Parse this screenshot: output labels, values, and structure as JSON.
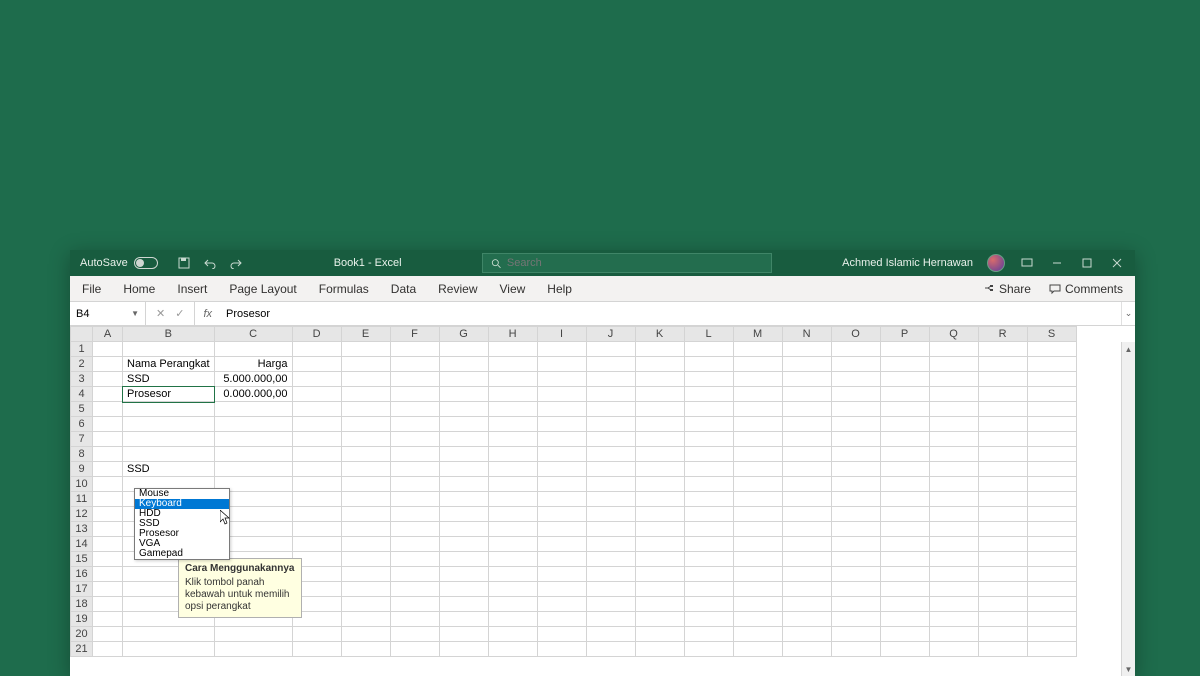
{
  "titlebar": {
    "autosave_label": "AutoSave",
    "autosave_state": "Off",
    "doc_title": "Book1  -  Excel",
    "search_placeholder": "Search",
    "user_name": "Achmed Islamic Hernawan"
  },
  "ribbon": {
    "tabs": [
      "File",
      "Home",
      "Insert",
      "Page Layout",
      "Formulas",
      "Data",
      "Review",
      "View",
      "Help"
    ],
    "share": "Share",
    "comments": "Comments"
  },
  "formula_bar": {
    "name_box": "B4",
    "fx_label": "fx",
    "formula": "Prosesor"
  },
  "columns": [
    "A",
    "B",
    "C",
    "D",
    "E",
    "F",
    "G",
    "H",
    "I",
    "J",
    "K",
    "L",
    "M",
    "N",
    "O",
    "P",
    "Q",
    "R",
    "S"
  ],
  "rows": [
    "1",
    "2",
    "3",
    "4",
    "5",
    "6",
    "7",
    "8",
    "9",
    "10",
    "11",
    "12",
    "13",
    "14",
    "15",
    "16",
    "17",
    "18",
    "19",
    "20",
    "21"
  ],
  "cells": {
    "B2": "Nama Perangkat",
    "C2": "Harga",
    "B3": "SSD",
    "C3": "5.000.000,00",
    "B4": "Prosesor",
    "C4": "0.000.000,00",
    "B9": "SSD"
  },
  "dropdown": {
    "items": [
      "Mouse",
      "Keyboard",
      "HDD",
      "SSD",
      "Prosesor",
      "VGA",
      "Gamepad"
    ],
    "selected_index": 1
  },
  "tooltip": {
    "title": "Cara Menggunakannya",
    "body": "Klik tombol panah kebawah untuk memilih opsi perangkat"
  }
}
